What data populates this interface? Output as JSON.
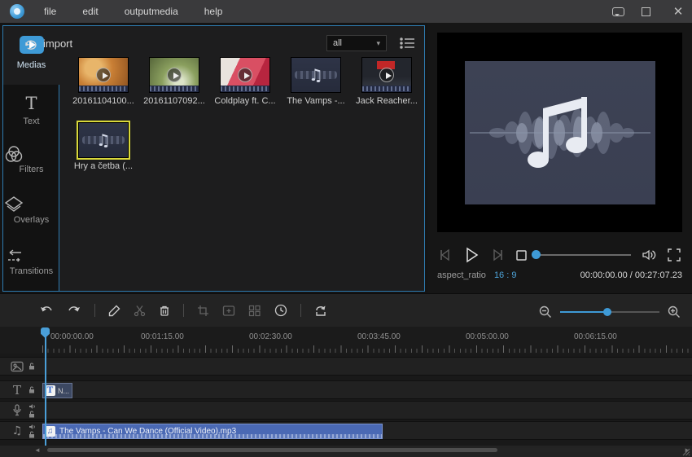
{
  "titlebar": {
    "menus": [
      {
        "label": "file"
      },
      {
        "label": "edit"
      },
      {
        "label": "outputmedia"
      },
      {
        "label": "help"
      }
    ]
  },
  "sidebar": {
    "items": [
      {
        "label": "Medias",
        "active": true
      },
      {
        "label": "Text",
        "active": false
      },
      {
        "label": "Filters",
        "active": false
      },
      {
        "label": "Overlays",
        "active": false
      },
      {
        "label": "Transitions",
        "active": false
      }
    ]
  },
  "media_panel": {
    "import_label": "import",
    "filter_selected": "all",
    "items": [
      {
        "name": "20161104100...",
        "type": "video"
      },
      {
        "name": "20161107092...",
        "type": "video"
      },
      {
        "name": "Coldplay ft. C...",
        "type": "video"
      },
      {
        "name": "The Vamps -...",
        "type": "audio"
      },
      {
        "name": "Jack Reacher...",
        "type": "video"
      },
      {
        "name": "Hry a četba (...",
        "type": "audio",
        "selected": true
      }
    ],
    "note_glyph": "♫"
  },
  "preview": {
    "aspect_label": "aspect_ratio",
    "aspect_value": "16 : 9",
    "timecode": "00:00:00.00 / 00:27:07.23"
  },
  "timeline": {
    "ruler_labels": [
      "00:00:00.00",
      "00:01:15.00",
      "00:02:30.00",
      "00:03:45.00",
      "00:05:00.00",
      "00:06:15.00"
    ],
    "tracks": [
      {
        "type": "video"
      },
      {
        "type": "text",
        "clip_label": "N...",
        "clip_icon": "T"
      },
      {
        "type": "voice"
      },
      {
        "type": "music",
        "clip_label": "The Vamps - Can We Dance (Official Video).mp3",
        "clip_icon": "♫"
      }
    ]
  },
  "colors": {
    "accent": "#3e9ad6",
    "panel_border": "#2e7bb0",
    "selection_yellow": "#d8d83a",
    "music_clip": "#4a69b4"
  }
}
